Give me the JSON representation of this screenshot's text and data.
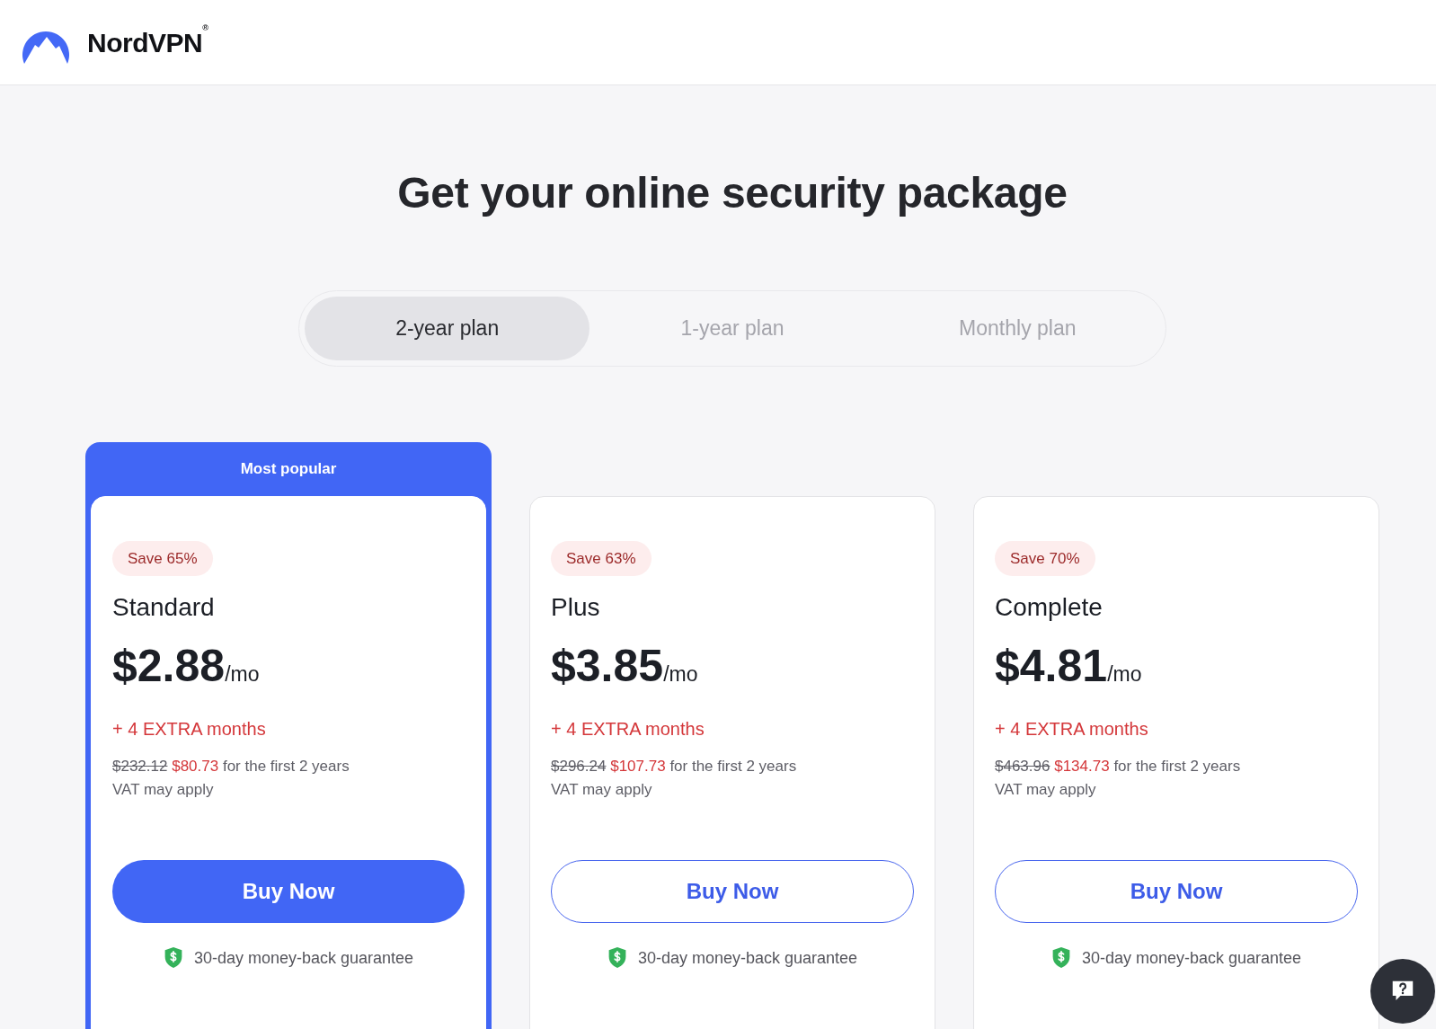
{
  "header": {
    "brand": "NordVPN$^{®}$"
  },
  "title": "Get your online security package",
  "plan_tabs": [
    {
      "label": "2-year plan",
      "selected": true
    },
    {
      "label": "1-year plan",
      "selected": false
    },
    {
      "label": "Monthly plan",
      "selected": false
    }
  ],
  "plans": [
    {
      "ribbon": "Most popular",
      "featured": true,
      "save": "Save 65%",
      "name": "Standard",
      "price": "$2.88",
      "per": "/mo",
      "bonus": "+ 4 EXTRA months",
      "old_price": "$232.12",
      "new_price": "$80.73",
      "price_note": "for the first 2 years",
      "vat": "VAT may apply",
      "button": "Buy Now",
      "guarantee": "30-day money-back guarantee"
    },
    {
      "featured": false,
      "save": "Save 63%",
      "name": "Plus",
      "price": "$3.85",
      "per": "/mo",
      "bonus": "+ 4 EXTRA months",
      "old_price": "$296.24",
      "new_price": "$107.73",
      "price_note": "for the first 2 years",
      "vat": "VAT may apply",
      "button": "Buy Now",
      "guarantee": "30-day money-back guarantee"
    },
    {
      "featured": false,
      "save": "Save 70%",
      "name": "Complete",
      "price": "$4.81",
      "per": "/mo",
      "bonus": "+ 4 EXTRA months",
      "old_price": "$463.96",
      "new_price": "$134.73",
      "price_note": "for the first 2 years",
      "vat": "VAT may apply",
      "button": "Buy Now",
      "guarantee": "30-day money-back guarantee"
    }
  ]
}
